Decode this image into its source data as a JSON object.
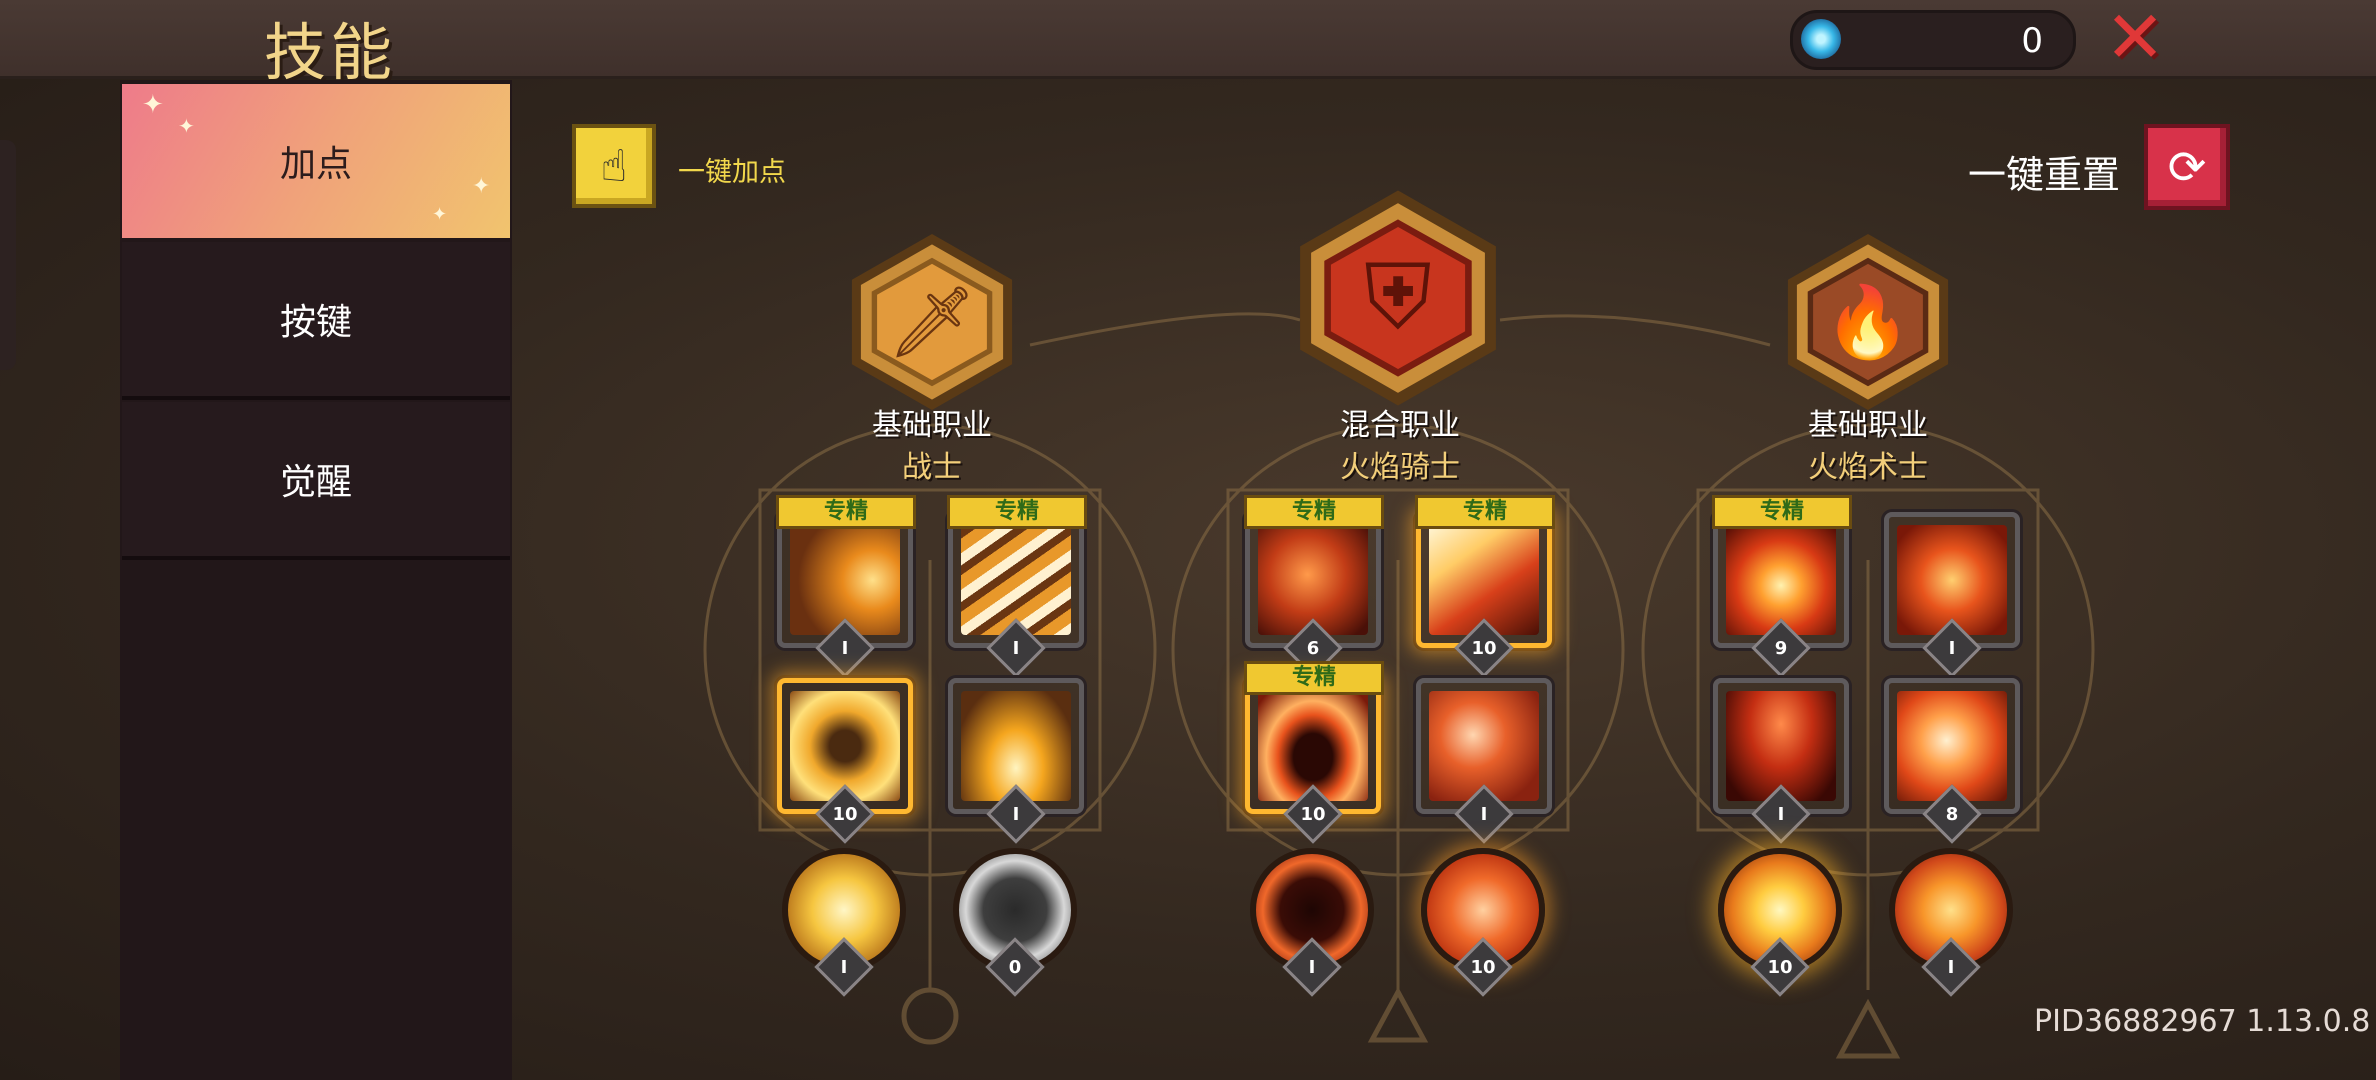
{
  "header": {
    "title": "技能",
    "currency_value": "0",
    "currency_icon": "blue-swirl-gem-icon",
    "close_icon": "close-x-icon"
  },
  "sidebar": {
    "items": [
      {
        "label": "加点",
        "active": true
      },
      {
        "label": "按键",
        "active": false
      },
      {
        "label": "觉醒",
        "active": false
      }
    ]
  },
  "actions": {
    "auto_assign_label": "一键加点",
    "reset_label": "一键重置"
  },
  "classes": [
    {
      "type": "基础职业",
      "name": "战士",
      "emblem": "sword-emblem-icon",
      "skills": [
        {
          "level": "I",
          "badge": "专精",
          "icon": "crescent-slash-icon"
        },
        {
          "level": "I",
          "badge": "专精",
          "icon": "claw-strike-icon"
        },
        {
          "level": "10",
          "badge": "",
          "icon": "war-cry-icon"
        },
        {
          "level": "I",
          "badge": "",
          "icon": "sword-ground-icon"
        },
        {
          "level": "I",
          "badge": "",
          "icon": "holy-sword-icon"
        },
        {
          "level": "0",
          "badge": "",
          "icon": "shadow-skull-icon"
        }
      ]
    },
    {
      "type": "混合职业",
      "name": "火焰骑士",
      "emblem": "knight-helmet-icon",
      "skills": [
        {
          "level": "6",
          "badge": "专精",
          "icon": "flame-dragon-icon"
        },
        {
          "level": "10",
          "badge": "专精",
          "icon": "fire-comet-icon"
        },
        {
          "level": "10",
          "badge": "专精",
          "icon": "fire-ring-icon"
        },
        {
          "level": "I",
          "badge": "",
          "icon": "fire-slash-icon"
        },
        {
          "level": "I",
          "badge": "",
          "icon": "fire-skull-icon"
        },
        {
          "level": "10",
          "badge": "",
          "icon": "flaming-sword-icon"
        }
      ]
    },
    {
      "type": "基础职业",
      "name": "火焰术士",
      "emblem": "flame-emblem-icon",
      "skills": [
        {
          "level": "9",
          "badge": "专精",
          "icon": "fireball-icon"
        },
        {
          "level": "I",
          "badge": "",
          "icon": "fire-serpent-icon"
        },
        {
          "level": "I",
          "badge": "",
          "icon": "volcano-icon"
        },
        {
          "level": "8",
          "badge": "",
          "icon": "fire-spiral-icon"
        },
        {
          "level": "10",
          "badge": "",
          "icon": "fire-star-icon"
        },
        {
          "level": "I",
          "badge": "",
          "icon": "fire-arrow-up-icon"
        }
      ]
    }
  ],
  "footer": {
    "pid": "PID36882967 1.13.0.8"
  },
  "colors": {
    "accent_gold": "#f2d58a",
    "close_red": "#e03838",
    "reset_red": "#d8324a",
    "badge_yellow": "#f0c830",
    "sidebar_active_gradient": [
      "#ee7b8a",
      "#f1c46e"
    ]
  }
}
